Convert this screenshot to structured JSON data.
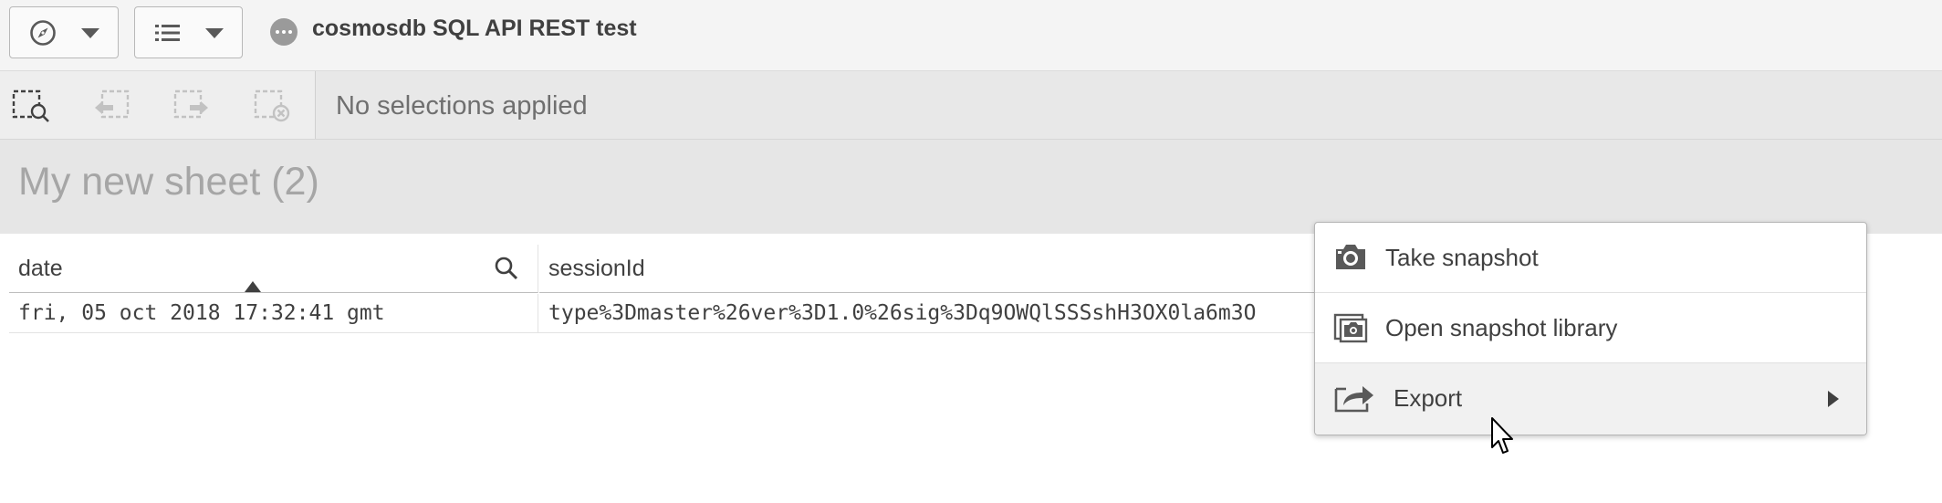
{
  "toolbar": {
    "nav_button_icon": "compass-icon",
    "sheet_list_button_icon": "list-icon",
    "app_icon": "app-dots-icon",
    "app_title": "cosmosdb SQL API REST test"
  },
  "selections": {
    "tools": [
      "smart-search-icon",
      "step-back-icon",
      "step-forward-icon",
      "clear-selections-icon"
    ],
    "status_text": "No selections applied"
  },
  "sheet": {
    "title": "My new sheet (2)"
  },
  "table": {
    "columns": [
      {
        "label": "date",
        "sorted": "ascending"
      },
      {
        "label": "sessionId"
      }
    ],
    "rows": [
      [
        "fri, 05 oct 2018 17:32:41 gmt",
        "type%3Dmaster%26ver%3D1.0%26sig%3Dq9OWQlSSSshH3OX0la6m3O"
      ]
    ]
  },
  "context_menu": {
    "items": [
      {
        "label": "Take snapshot",
        "icon": "camera-icon"
      },
      {
        "label": "Open snapshot library",
        "icon": "snapshot-library-icon"
      },
      {
        "label": "Export",
        "icon": "export-icon",
        "has_submenu": true,
        "highlighted": true
      }
    ]
  },
  "colors": {
    "toolbar_bg": "#f4f4f4",
    "selection_bar_bg": "#e8e8e8",
    "sheet_bar_bg": "#e6e6e6",
    "text": "#404040",
    "muted_text": "#a6a6a6",
    "menu_hover_bg": "#f1f1f1"
  }
}
